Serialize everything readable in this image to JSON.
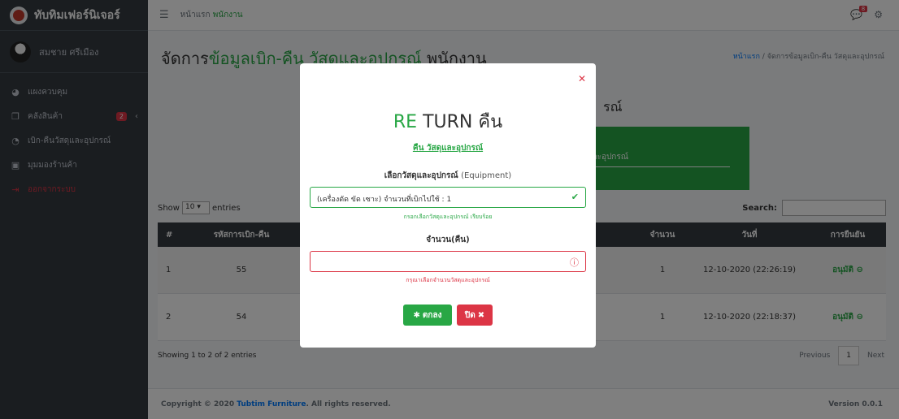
{
  "sidebar": {
    "brand": "ทับทิมเฟอร์นิเจอร์",
    "user_name": "สมชาย ศรีเมือง",
    "items": [
      {
        "label": "แผงควบคุม",
        "icon": "dashboard-icon"
      },
      {
        "label": "คลังสินค้า",
        "icon": "copy-icon",
        "badge": "2"
      },
      {
        "label": "เบิก-คืนวัสดุและอุปกรณ์",
        "icon": "pie-chart-icon"
      },
      {
        "label": "มุมมองร้านค้า",
        "icon": "image-icon"
      },
      {
        "label": "ออกจากระบบ",
        "icon": "sign-out-icon"
      }
    ]
  },
  "navbar": {
    "home": "หน้าแรก",
    "current": "พนักงาน",
    "notif_badge": "8"
  },
  "page": {
    "title_prefix": "จัดการ",
    "title_accent": "ข้อมูลเบิก-คืน วัสดุและอุปกรณ์",
    "title_suffix": " พนักงาน",
    "breadcrumb_home": "หน้าแรก",
    "breadcrumb_sep": "/",
    "breadcrumb_current": "จัดการข้อมูลเบิก-คืน วัสดุและอุปกรณ์",
    "section_title": "รณ์",
    "green_box_text": "และอุปกรณ์"
  },
  "table": {
    "show_label": "Show",
    "show_value": "10",
    "entries_label": "entries",
    "search_label": "Search:",
    "headers": [
      "#",
      "รหัสการเบิก-คืน",
      "",
      "จำนวน",
      "วันที่",
      "การยืนยัน"
    ],
    "rows": [
      {
        "no": "1",
        "code": "55",
        "qty": "1",
        "date": "12-10-2020 (22:26:19)",
        "status": "อนุมัติ"
      },
      {
        "no": "2",
        "code": "54",
        "qty": "1",
        "date": "12-10-2020 (22:18:37)",
        "status": "อนุมัติ"
      }
    ],
    "showing": "Showing 1 to 2 of 2 entries",
    "previous": "Previous",
    "page": "1",
    "next": "Next"
  },
  "footer": {
    "copyright": "Copyright © 2020 ",
    "company": "Tubtim Furniture",
    "rights": ". All rights reserved.",
    "version": "Version 0.0.1"
  },
  "modal": {
    "title_re": "RE",
    "title_rest": " TURN คืน",
    "subtitle": "คืน วัสดุและอุปกรณ์",
    "equipment_label": "เลือกวัสดุและอุปกรณ์",
    "equipment_label_en": "(Equipment)",
    "equipment_value": "(เครื่องตัด ขัด เซาะ) จำนวนที่เบิกไปใช้ : 1",
    "equipment_feedback": "กรอกเลือกวัสดุและอุปกรณ์ เรียบร้อย",
    "qty_label": "จำนวน(คืน)",
    "qty_value": "",
    "qty_feedback": "กรุณาเลือกจำนวนวัสดุและอุปกรณ์",
    "ok_label": "ตกลง",
    "close_label": "ปิด"
  }
}
